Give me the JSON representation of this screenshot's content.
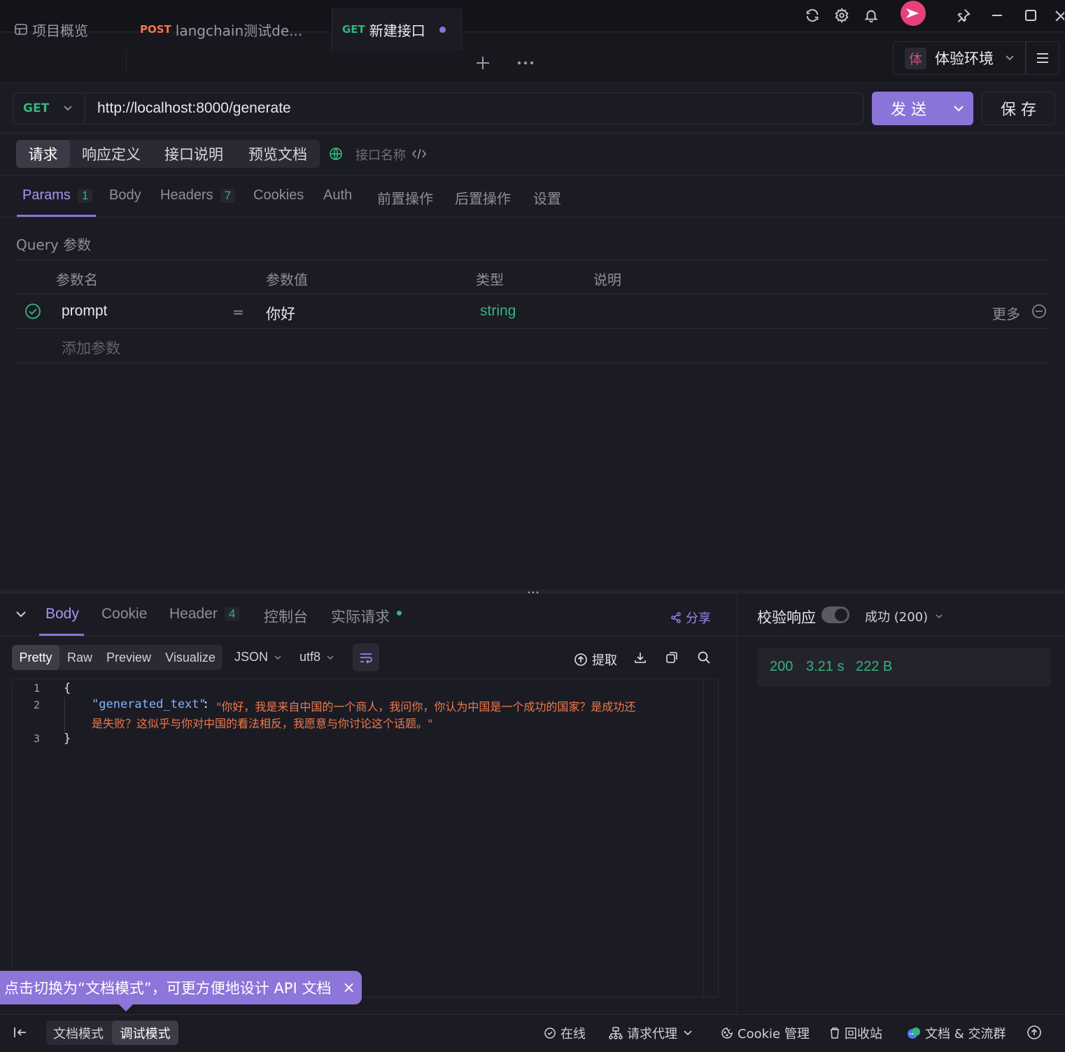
{
  "window": {
    "icons": [
      "refresh-icon",
      "settings-icon",
      "bell-icon",
      "avatar",
      "pin-icon",
      "minimize-icon",
      "maximize-icon",
      "close-icon"
    ]
  },
  "tabs": {
    "overview_label": "项目概览",
    "tab1_method": "POST",
    "tab1_label": "langchain测试de...",
    "tab2_method": "GET",
    "tab2_label": "新建接口",
    "env_badge": "体",
    "env_label": "体验环境"
  },
  "request": {
    "method": "GET",
    "url": "http://localhost:8000/generate",
    "send_label": "发 送",
    "save_label": "保 存"
  },
  "modes": {
    "items": [
      "请求",
      "响应定义",
      "接口说明",
      "预览文档"
    ],
    "active": "请求",
    "name_placeholder": "接口名称"
  },
  "param_tabs": {
    "params": "Params",
    "params_count": "1",
    "body": "Body",
    "headers": "Headers",
    "headers_count": "7",
    "cookies": "Cookies",
    "auth": "Auth",
    "pre": "前置操作",
    "post": "后置操作",
    "settings": "设置"
  },
  "query": {
    "section_title": "Query 参数",
    "col_name": "参数名",
    "col_value": "参数值",
    "col_type": "类型",
    "col_desc": "说明",
    "rows": [
      {
        "name": "prompt",
        "eq": "=",
        "value": "你好",
        "type": "string",
        "more": "更多"
      }
    ],
    "add_label": "添加参数"
  },
  "response": {
    "tabs": {
      "body": "Body",
      "cookie": "Cookie",
      "header": "Header",
      "header_count": "4",
      "console": "控制台",
      "actual": "实际请求"
    },
    "share_label": "分享",
    "formats": [
      "Pretty",
      "Raw",
      "Preview",
      "Visualize"
    ],
    "format_active": "Pretty",
    "lang": "JSON",
    "encoding": "utf8",
    "extract_label": "提取",
    "code_lines": {
      "l1": "{",
      "l2_key": "\"generated_text\"",
      "l2_colon": ": ",
      "l2_val_a": "\"你好，我是来自中国的一个商人，我问你，你认为中国是一个成功的国家？是成功还",
      "l2_val_b": "是失败？这似乎与你对中国的看法相反，我愿意与你讨论这个话题。\"",
      "l3": "}"
    },
    "line_numbers": [
      "1",
      "2",
      "3"
    ]
  },
  "validation": {
    "label": "校验响应",
    "status_select": "成功 (200)",
    "status_code": "200",
    "time": "3.21 s",
    "size": "222 B"
  },
  "tooltip": {
    "text": "点击切换为“文档模式”，可更方便地设计 API 文档",
    "close": "×"
  },
  "statusbar": {
    "doc_mode": "文档模式",
    "debug_mode": "调试模式",
    "online": "在线",
    "proxy": "请求代理",
    "cookie": "Cookie 管理",
    "recycle": "回收站",
    "docs": "文档 & 交流群"
  },
  "colors": {
    "accent": "#8b74d8",
    "get": "#36b37e",
    "post": "#ef7a4b",
    "background": "#1b1b24"
  }
}
